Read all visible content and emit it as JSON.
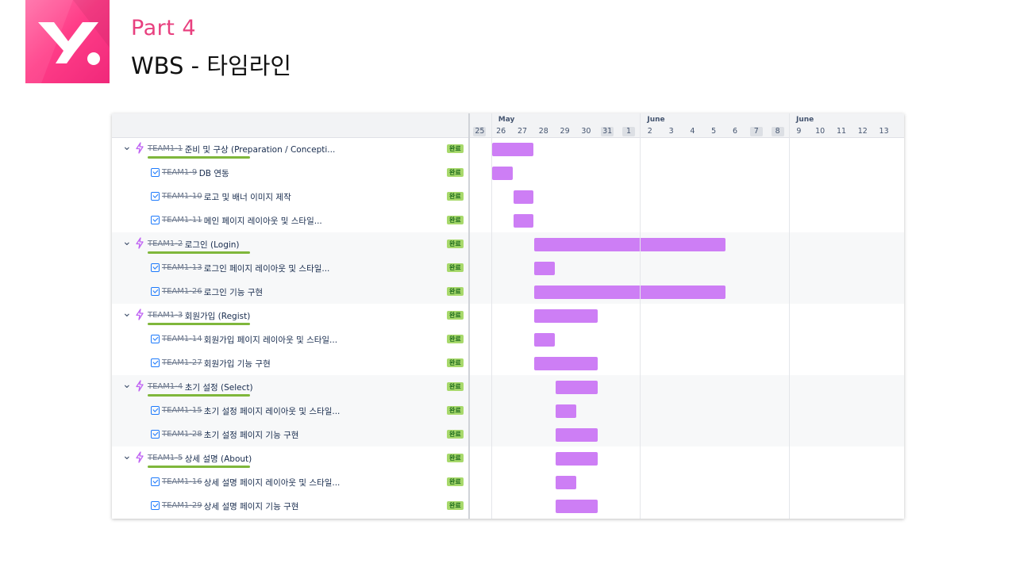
{
  "header": {
    "part": "Part 4",
    "title": "WBS - 타임라인"
  },
  "logo": {
    "name": "logo",
    "colors": [
      "#ff6fa8",
      "#f0287a"
    ]
  },
  "timeline": {
    "months": [
      {
        "label": "May",
        "start_day_index": 1
      },
      {
        "label": "June",
        "start_day_index": 8
      },
      {
        "label": "June",
        "start_day_index": 15
      }
    ],
    "days": [
      "25",
      "26",
      "27",
      "28",
      "29",
      "30",
      "31",
      "1",
      "2",
      "3",
      "4",
      "5",
      "6",
      "7",
      "8",
      "9",
      "10",
      "11",
      "12",
      "13"
    ],
    "weekend_days": [
      "25",
      "31",
      "1",
      "7",
      "8"
    ],
    "bar_color": "#cd7ef5"
  },
  "status_badge": "완료",
  "rows": [
    {
      "type": "epic",
      "key": "TEAM1-1",
      "name": "준비 및 구상 (Preparation / Concepti...",
      "status": "완료",
      "bar_start": "26",
      "bar_end": "27",
      "shaded": false
    },
    {
      "type": "task",
      "key": "TEAM1-9",
      "name": "DB 연동",
      "status": "완료",
      "bar_start": "26",
      "bar_end": "26",
      "shaded": false
    },
    {
      "type": "task",
      "key": "TEAM1-10",
      "name": "로고 및 배너 이미지 제작",
      "status": "완료",
      "bar_start": "27",
      "bar_end": "27",
      "shaded": false
    },
    {
      "type": "task",
      "key": "TEAM1-11",
      "name": "메인 페이지 레이아웃 및 스타일...",
      "status": "완료",
      "bar_start": "27",
      "bar_end": "27",
      "shaded": false
    },
    {
      "type": "epic",
      "key": "TEAM1-2",
      "name": "로그인 (Login)",
      "status": "완료",
      "bar_start": "28",
      "bar_end": "5",
      "shaded": true
    },
    {
      "type": "task",
      "key": "TEAM1-13",
      "name": "로그인 페이지 레이아웃 및 스타일...",
      "status": "완료",
      "bar_start": "28",
      "bar_end": "28",
      "shaded": true
    },
    {
      "type": "task",
      "key": "TEAM1-26",
      "name": "로그인 기능 구현",
      "status": "완료",
      "bar_start": "28",
      "bar_end": "5",
      "shaded": true
    },
    {
      "type": "epic",
      "key": "TEAM1-3",
      "name": "회원가입 (Regist)",
      "status": "완료",
      "bar_start": "28",
      "bar_end": "30",
      "shaded": false
    },
    {
      "type": "task",
      "key": "TEAM1-14",
      "name": "회원가입 페이지 레이아웃 및 스타일...",
      "status": "완료",
      "bar_start": "28",
      "bar_end": "28",
      "shaded": false
    },
    {
      "type": "task",
      "key": "TEAM1-27",
      "name": "회원가입 기능 구현",
      "status": "완료",
      "bar_start": "28",
      "bar_end": "30",
      "shaded": false
    },
    {
      "type": "epic",
      "key": "TEAM1-4",
      "name": "초기 설정 (Select)",
      "status": "완료",
      "bar_start": "29",
      "bar_end": "30",
      "shaded": true
    },
    {
      "type": "task",
      "key": "TEAM1-15",
      "name": "초기 설정 페이지 레이아웃 및 스타일...",
      "status": "완료",
      "bar_start": "29",
      "bar_end": "29",
      "shaded": true
    },
    {
      "type": "task",
      "key": "TEAM1-28",
      "name": "초기 설정 페이지 기능 구현",
      "status": "완료",
      "bar_start": "29",
      "bar_end": "30",
      "shaded": true
    },
    {
      "type": "epic",
      "key": "TEAM1-5",
      "name": "상세 설명 (About)",
      "status": "완료",
      "bar_start": "29",
      "bar_end": "30",
      "shaded": false
    },
    {
      "type": "task",
      "key": "TEAM1-16",
      "name": "상세 설명 페이지 레이아웃 및 스타일...",
      "status": "완료",
      "bar_start": "29",
      "bar_end": "29",
      "shaded": false
    },
    {
      "type": "task",
      "key": "TEAM1-29",
      "name": "상세 설명 페이지 기능 구현",
      "status": "완료",
      "bar_start": "29",
      "bar_end": "30",
      "shaded": false
    }
  ]
}
